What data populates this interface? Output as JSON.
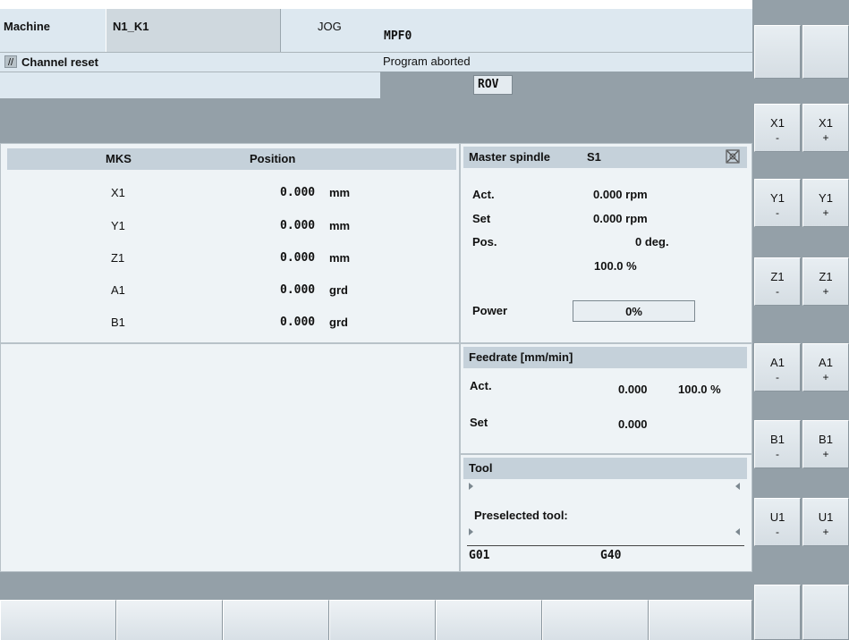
{
  "header": {
    "machine_label": "Machine",
    "channel_name": "N1_K1",
    "mode": "JOG",
    "program": "MPF0",
    "channel_status": "Channel reset",
    "program_status": "Program aborted",
    "rov": "ROV"
  },
  "axes_table": {
    "col_system": "MKS",
    "col_position": "Position",
    "rows": [
      {
        "axis": "X1",
        "value": "0.000",
        "unit": "mm"
      },
      {
        "axis": "Y1",
        "value": "0.000",
        "unit": "mm"
      },
      {
        "axis": "Z1",
        "value": "0.000",
        "unit": "mm"
      },
      {
        "axis": "A1",
        "value": "0.000",
        "unit": "grd"
      },
      {
        "axis": "B1",
        "value": "0.000",
        "unit": "grd"
      }
    ]
  },
  "spindle": {
    "title": "Master spindle",
    "name": "S1",
    "act_label": "Act.",
    "act_value": "0.000 rpm",
    "set_label": "Set",
    "set_value": "0.000 rpm",
    "pos_label": "Pos.",
    "pos_value": "0 deg.",
    "override": "100.0 %",
    "power_label": "Power",
    "power_value": "0%",
    "status_icon": "spindle-stop-icon"
  },
  "feedrate": {
    "title": "Feedrate [mm/min]",
    "act_label": "Act.",
    "act_value": "0.000",
    "override": "100.0 %",
    "set_label": "Set",
    "set_value": "0.000"
  },
  "tool": {
    "title": "Tool",
    "preselected_label": "Preselected tool:",
    "gcode1": "G01",
    "gcode2": "G40"
  },
  "softkeys_right": [
    {
      "axis": "X1",
      "minus": "-",
      "plus": "+"
    },
    {
      "axis": "Y1",
      "minus": "-",
      "plus": "+"
    },
    {
      "axis": "Z1",
      "minus": "-",
      "plus": "+"
    },
    {
      "axis": "A1",
      "minus": "-",
      "plus": "+"
    },
    {
      "axis": "B1",
      "minus": "-",
      "plus": "+"
    },
    {
      "axis": "U1",
      "minus": "-",
      "plus": "+"
    }
  ],
  "colors": {
    "header_light": "#dde8f0",
    "header_gray": "#94a0a8",
    "panel_bg": "#eef3f6",
    "panel_head": "#c5d1da"
  }
}
